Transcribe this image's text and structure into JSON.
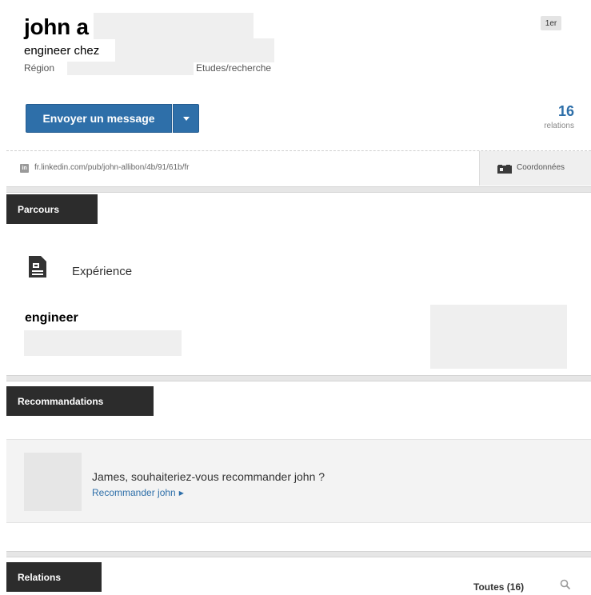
{
  "profile": {
    "name": "john a",
    "headline": "engineer chez",
    "region_label": "Région",
    "industry": "Etudes/recherche",
    "degree": "1er",
    "message_button": "Envoyer un message",
    "connections_count": "16",
    "connections_label": "relations",
    "public_url": "fr.linkedin.com/pub/john-allibon/4b/91/61b/fr",
    "contact_info": "Coordonnées",
    "linkedin_icon_text": "in"
  },
  "sections": {
    "parcours": {
      "title": "Parcours",
      "experience_label": "Expérience",
      "job_title": "engineer"
    },
    "recommendations": {
      "title": "Recommandations",
      "question": "James, souhaiteriez-vous recommander john ?",
      "link": "Recommander john",
      "link_arrow": "▶"
    },
    "relations": {
      "title": "Relations",
      "all_label": "Toutes (16)"
    }
  },
  "colors": {
    "accent": "#2e6fa9",
    "tab_bg": "#2c2c2c",
    "redaction": "#efefef"
  },
  "icons": [
    "linkedin-icon",
    "contact-card-icon",
    "experience-document-icon",
    "chevron-down-icon",
    "search-icon",
    "arrow-right-icon"
  ]
}
